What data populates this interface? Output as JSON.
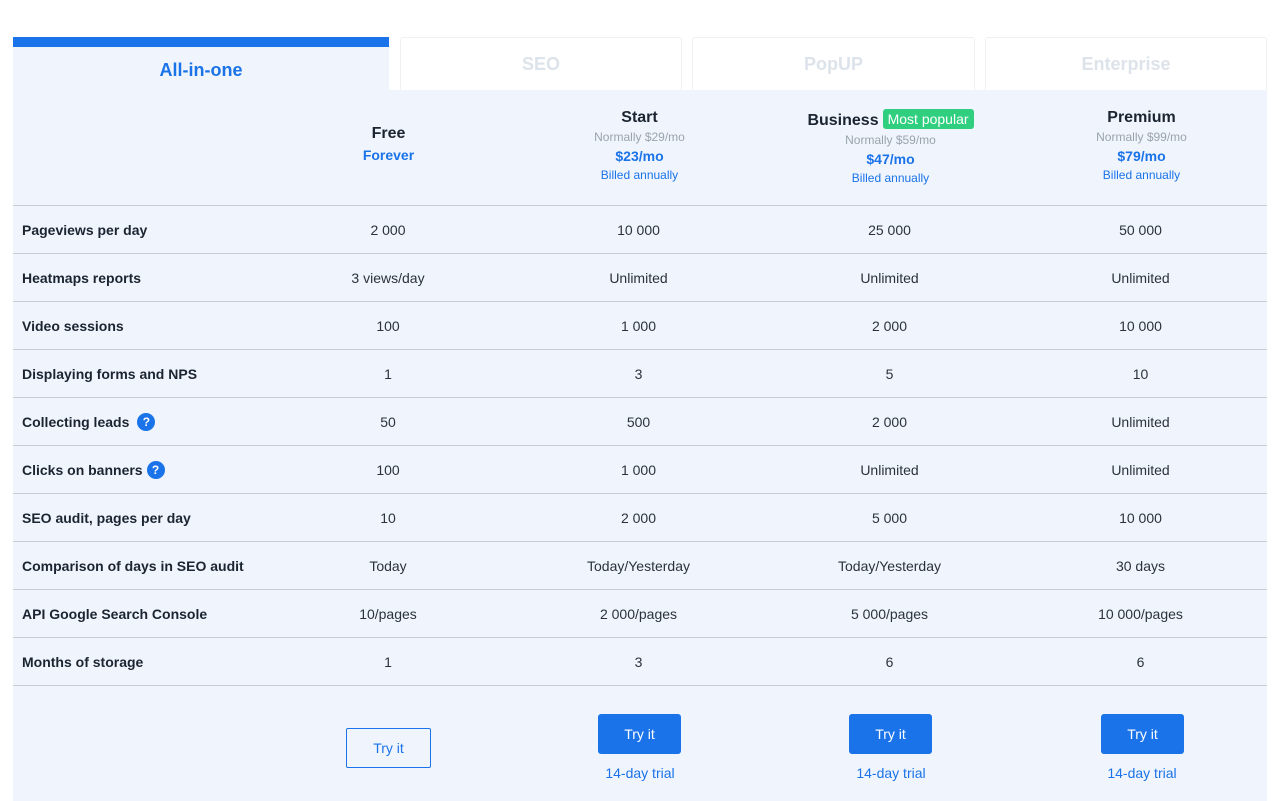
{
  "tabs": [
    "All-in-one",
    "SEO",
    "PopUP",
    "Enterprise"
  ],
  "plans": {
    "free": {
      "name": "Free",
      "note": "Forever"
    },
    "start": {
      "name": "Start",
      "normally": "Normally $29/mo",
      "price": "$23/mo",
      "billed": "Billed annually"
    },
    "business": {
      "name": "Business",
      "badge": "Most popular",
      "normally": "Normally $59/mo",
      "price": "$47/mo",
      "billed": "Billed annually"
    },
    "premium": {
      "name": "Premium",
      "normally": "Normally $99/mo",
      "price": "$79/mo",
      "billed": "Billed annually"
    }
  },
  "features": [
    {
      "label": "Pageviews per day",
      "values": [
        "2 000",
        "10 000",
        "25 000",
        "50 000"
      ]
    },
    {
      "label": "Heatmaps reports",
      "values": [
        "3 views/day",
        "Unlimited",
        "Unlimited",
        "Unlimited"
      ]
    },
    {
      "label": "Video sessions",
      "values": [
        "100",
        "1 000",
        "2 000",
        "10 000"
      ]
    },
    {
      "label": "Displaying forms and NPS",
      "values": [
        "1",
        "3",
        "5",
        "10"
      ]
    },
    {
      "label": "Collecting leads",
      "values": [
        "50",
        "500",
        "2 000",
        "Unlimited"
      ]
    },
    {
      "label": "Clicks on banners",
      "values": [
        "100",
        "1 000",
        "Unlimited",
        "Unlimited"
      ]
    },
    {
      "label": "SEO audit, pages per day",
      "values": [
        "10",
        "2 000",
        "5 000",
        "10 000"
      ]
    },
    {
      "label": "Comparison of days in SEO audit",
      "values": [
        "Today",
        "Today/Yesterday",
        "Today/Yesterday",
        "30 days"
      ]
    },
    {
      "label": "API Google Search Console",
      "values": [
        "10/pages",
        "2 000/pages",
        "5 000/pages",
        "10 000/pages"
      ]
    },
    {
      "label": "Months of storage",
      "values": [
        "1",
        "3",
        "6",
        "6"
      ]
    }
  ],
  "help_glyph": "?",
  "actions": {
    "try_label": "Try it",
    "trial_label": "14-day trial"
  },
  "colors": {
    "accent": "#1a73e8",
    "badge": "#2fcf7f",
    "panel": "#f0f5fd"
  }
}
